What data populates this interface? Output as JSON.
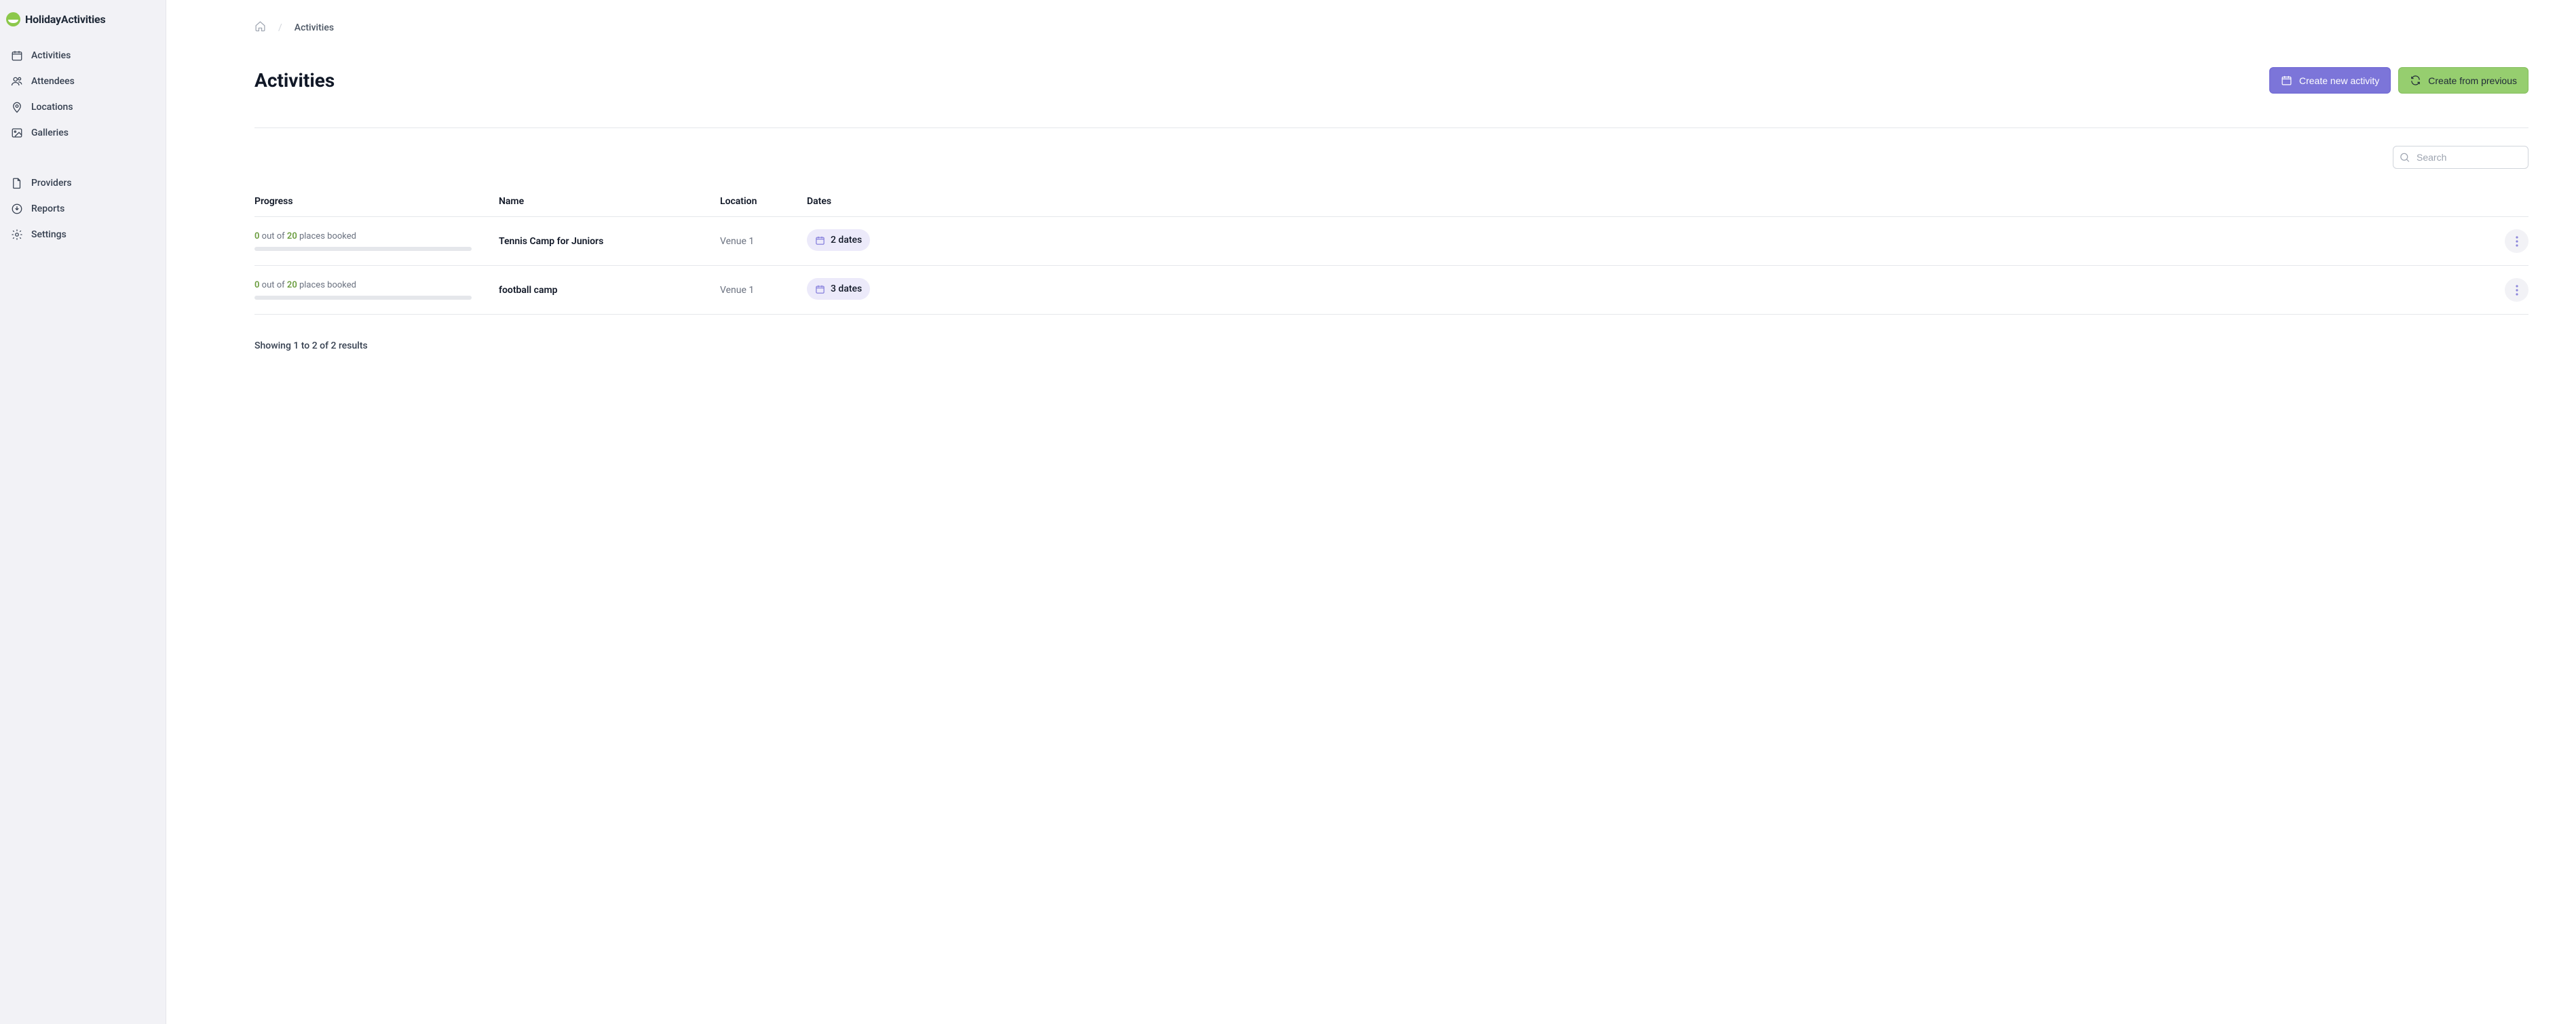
{
  "brand": {
    "name": "HolidayActivities"
  },
  "sidebar": {
    "primary": [
      {
        "label": "Activities",
        "icon": "calendar"
      },
      {
        "label": "Attendees",
        "icon": "users"
      },
      {
        "label": "Locations",
        "icon": "map-pin"
      },
      {
        "label": "Galleries",
        "icon": "image"
      }
    ],
    "secondary": [
      {
        "label": "Providers",
        "icon": "file"
      },
      {
        "label": "Reports",
        "icon": "download"
      },
      {
        "label": "Settings",
        "icon": "gear"
      }
    ]
  },
  "breadcrumb": {
    "current": "Activities"
  },
  "header": {
    "title": "Activities",
    "create_new": "Create new activity",
    "create_from_previous": "Create from previous"
  },
  "search": {
    "placeholder": "Search",
    "value": ""
  },
  "table": {
    "headers": {
      "progress": "Progress",
      "name": "Name",
      "location": "Location",
      "dates": "Dates"
    },
    "rows": [
      {
        "booked": "0",
        "mid": " out of ",
        "total": "20",
        "suffix": " places booked",
        "name": "Tennis Camp for Juniors",
        "location": "Venue 1",
        "dates_label": "2 dates"
      },
      {
        "booked": "0",
        "mid": " out of ",
        "total": "20",
        "suffix": " places booked",
        "name": "football camp",
        "location": "Venue 1",
        "dates_label": "3 dates"
      }
    ]
  },
  "footer": {
    "results": "Showing 1 to 2 of 2 results"
  }
}
